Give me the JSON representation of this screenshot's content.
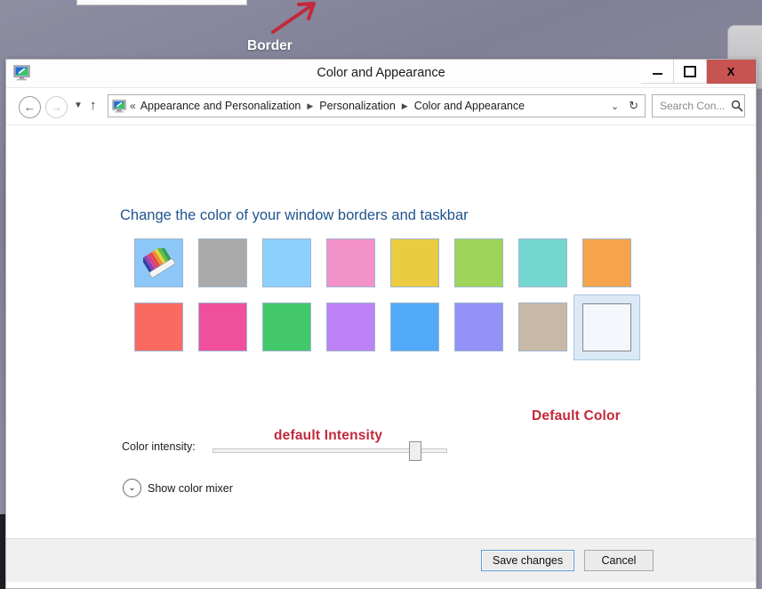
{
  "window": {
    "title": "Color and Appearance",
    "icon": "display-monitor-icon",
    "controls": {
      "minimize": "–",
      "maximize": "□",
      "close": "X"
    }
  },
  "nav": {
    "back": "←",
    "forward": "→",
    "recent_chevron": "▼",
    "up": "↑",
    "address_icon": "display-monitor-icon",
    "breadcrumb_prefix": "«",
    "breadcrumbs": [
      "Appearance and Personalization",
      "Personalization",
      "Color and Appearance"
    ],
    "breadcrumb_separator": "▶",
    "dropdown_chevron": "⌄",
    "refresh": "↻"
  },
  "search": {
    "placeholder": "Search Con...",
    "value": "",
    "icon": "magnifier-icon"
  },
  "main": {
    "heading": "Change the color of your window borders and taskbar",
    "swatch_rows": [
      [
        {
          "name": "automatic-color",
          "color": "#8cc7f7",
          "selected": false,
          "is_auto": true
        },
        {
          "name": "gray",
          "color": "#aaaaaa",
          "selected": false
        },
        {
          "name": "sky-blue",
          "color": "#8cd0fd",
          "selected": false
        },
        {
          "name": "pink",
          "color": "#f291ca",
          "selected": false
        },
        {
          "name": "yellow",
          "color": "#ebcc41",
          "selected": false
        },
        {
          "name": "lime-green",
          "color": "#9ed45a",
          "selected": false
        },
        {
          "name": "turquoise",
          "color": "#74d6d0",
          "selected": false
        },
        {
          "name": "orange",
          "color": "#f5a council",
          "selected": false
        }
      ],
      [
        {
          "name": "coral-red",
          "color": "#fb6a60",
          "selected": false
        },
        {
          "name": "hot-pink",
          "color": "#f04f9e",
          "selected": false
        },
        {
          "name": "green",
          "color": "#42c76a",
          "selected": false
        },
        {
          "name": "violet",
          "color": "#bd82f5",
          "selected": false
        },
        {
          "name": "blue",
          "color": "#52a9f7",
          "selected": false
        },
        {
          "name": "periwinkle",
          "color": "#9491f7",
          "selected": false
        },
        {
          "name": "taupe",
          "color": "#c8b8a7",
          "selected": false
        },
        {
          "name": "default-white",
          "color": "#f4f7fb",
          "selected": true
        }
      ]
    ],
    "intensity_label": "Color intensity:",
    "intensity_value": 84,
    "mixer_toggle_label": "Show color mixer",
    "mixer_chevron": "⌄"
  },
  "footer": {
    "save_label": "Save changes",
    "cancel_label": "Cancel"
  },
  "annotations": {
    "color": "#c2293a",
    "border_label": "Border",
    "intensity_label": "default Intensity",
    "default_color_label": "Default Color"
  }
}
